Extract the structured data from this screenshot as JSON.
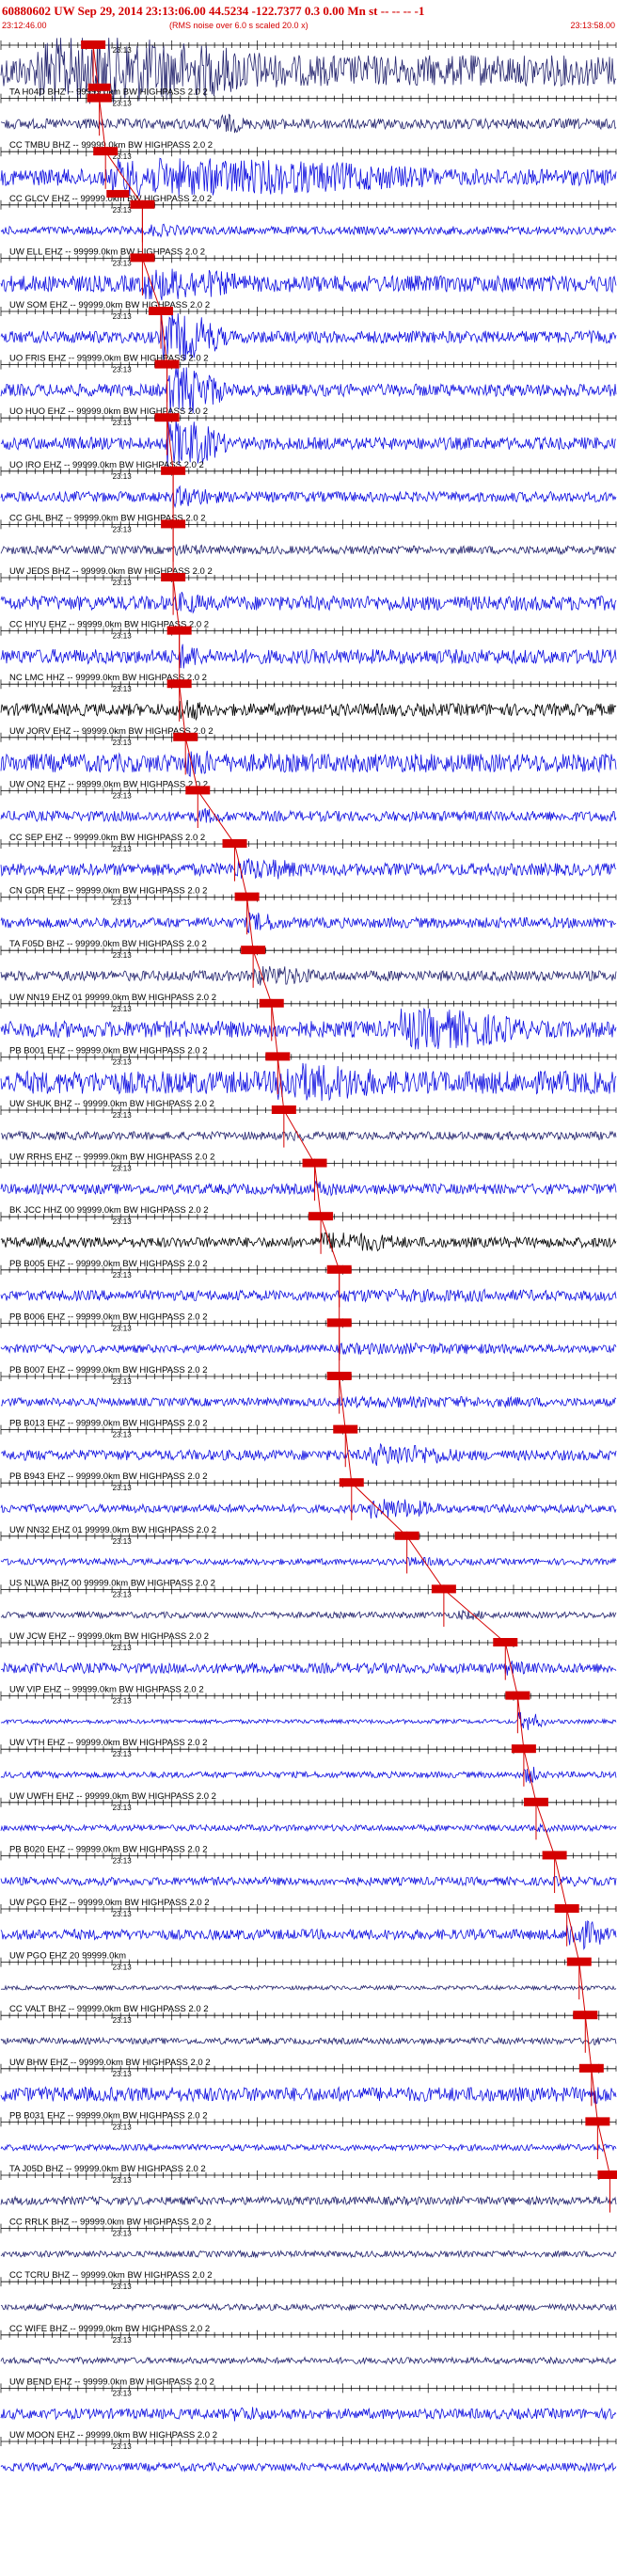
{
  "header": {
    "title": "60880602 UW Sep 29, 2014 23:13:06.00   44.5234 -122.7377  0.3 0.00 Mn st -- -- --  -1",
    "start_time": "23:12:46.00",
    "note": "(RMS noise over 6.0 s scaled 20.0 x)",
    "end_time": "23:13:58.00"
  },
  "colors": {
    "header_text": "#d40000",
    "trace_blue": "#1010e0",
    "trace_navy": "#24246e",
    "trace_black": "#000000",
    "pick_marker": "#d40000",
    "baseline": "#000000"
  },
  "minute_label": "'23:13",
  "chart_data": {
    "type": "seismogram",
    "time_start": "23:12:46.00",
    "time_end": "23:13:58.00",
    "event_origin": "23:13:06.00",
    "traces": [
      {
        "label": "",
        "color": "navy",
        "amp": 30,
        "burst_start": 0.06,
        "burst_end": 0.45,
        "burst_amp": 2.2,
        "pick": 0.15,
        "second_pick": 0.16
      },
      {
        "label": "TA H04D BHZ -- 99999.0km BW  HIGHPASS  2.0  2",
        "color": "navy",
        "amp": 10,
        "burst_start": 0.35,
        "burst_end": 0.4,
        "burst_amp": 2.0,
        "pick": 0.16
      },
      {
        "label": "CC TMBU BHZ -- 99999.0km BW  HIGHPASS  2.0  2",
        "color": "blue",
        "amp": 16,
        "burst_start": 0.18,
        "burst_end": 0.72,
        "burst_amp": 2.3,
        "pick": 0.17,
        "second_pick": 0.19
      },
      {
        "label": "CC GLCV EHZ -- 99999.0km BW  HIGHPASS  2.0  2",
        "color": "blue",
        "amp": 8,
        "burst_start": 0.24,
        "burst_end": 0.3,
        "burst_amp": 1.6,
        "pick": 0.23
      },
      {
        "label": "UW ELL EHZ -- 99999.0km BW  HIGHPASS  2.0  2",
        "color": "blue",
        "amp": 16,
        "burst_start": 0.23,
        "burst_end": 0.4,
        "burst_amp": 2.0,
        "pick": 0.23
      },
      {
        "label": "UW SOM EHZ -- 99999.0km BW  HIGHPASS  2.0  2",
        "color": "blue",
        "amp": 12,
        "burst_start": 0.26,
        "burst_end": 0.37,
        "burst_amp": 4.0,
        "pick": 0.26
      },
      {
        "label": "UO FRIS EHZ -- 99999.0km BW  HIGHPASS  2.0  2",
        "color": "blue",
        "amp": 12,
        "burst_start": 0.27,
        "burst_end": 0.37,
        "burst_amp": 4.0,
        "pick": 0.27
      },
      {
        "label": "UO HUO EHZ -- 99999.0km BW  HIGHPASS  2.0  2",
        "color": "blue",
        "amp": 12,
        "burst_start": 0.27,
        "burst_end": 0.37,
        "burst_amp": 4.0,
        "pick": 0.27
      },
      {
        "label": "UO IRO EHZ -- 99999.0km BW  HIGHPASS  2.0  2",
        "color": "blue",
        "amp": 10,
        "burst_start": 0.28,
        "burst_end": 0.36,
        "burst_amp": 2.0,
        "pick": 0.28
      },
      {
        "label": "CC GHL BHZ -- 99999.0km BW  HIGHPASS  2.0  2",
        "color": "navy",
        "amp": 8,
        "burst_start": 0.28,
        "burst_end": 0.34,
        "burst_amp": 1.4,
        "pick": 0.28
      },
      {
        "label": "UW JEDS BHZ -- 99999.0km BW  HIGHPASS  2.0  2",
        "color": "blue",
        "amp": 14,
        "burst_start": 0.29,
        "burst_end": 0.33,
        "burst_amp": 1.6,
        "pick": 0.28
      },
      {
        "label": "CC HIYU EHZ -- 99999.0km BW  HIGHPASS  2.0  2",
        "color": "blue",
        "amp": 14,
        "burst_start": 0.29,
        "burst_end": 0.33,
        "burst_amp": 1.8,
        "pick": 0.29
      },
      {
        "label": "NC LMC HHZ -- 99999.0km BW  HIGHPASS  2.0  2",
        "color": "black",
        "amp": 12,
        "burst_start": 0.29,
        "burst_end": 0.33,
        "burst_amp": 2.0,
        "pick": 0.29
      },
      {
        "label": "UW JORV EHZ -- 99999.0km BW  HIGHPASS  2.0  2",
        "color": "blue",
        "amp": 18,
        "burst_start": 0.3,
        "burst_end": 0.35,
        "burst_amp": 1.6,
        "pick": 0.3
      },
      {
        "label": "UW ON2 EHZ -- 99999.0km BW  HIGHPASS  2.0  2",
        "color": "blue",
        "amp": 10,
        "burst_start": 0.32,
        "burst_end": 0.36,
        "burst_amp": 1.6,
        "pick": 0.32
      },
      {
        "label": "CC SEP EHZ -- 99999.0km BW  HIGHPASS  2.0  2",
        "color": "blue",
        "amp": 12,
        "burst_start": 0.38,
        "burst_end": 0.5,
        "burst_amp": 1.8,
        "pick": 0.38
      },
      {
        "label": "CN GDR EHZ -- 99999.0km BW  HIGHPASS  2.0  2",
        "color": "blue",
        "amp": 10,
        "burst_start": 0.4,
        "burst_end": 0.46,
        "burst_amp": 2.0,
        "pick": 0.4
      },
      {
        "label": "TA F05D BHZ -- 99999.0km BW  HIGHPASS  2.0  2",
        "color": "navy",
        "amp": 10,
        "burst_start": 0.41,
        "burst_end": 0.52,
        "burst_amp": 2.0,
        "pick": 0.41
      },
      {
        "label": "UW NN19 EHZ 01 99999.0km BW  HIGHPASS  2.0  2",
        "color": "blue",
        "amp": 16,
        "burst_start": 0.65,
        "burst_end": 0.86,
        "burst_amp": 2.5,
        "pick": 0.44
      },
      {
        "label": "PB B001 EHZ -- 99999.0km BW  HIGHPASS  2.0  2",
        "color": "blue",
        "amp": 22,
        "burst_start": 0.45,
        "burst_end": 0.62,
        "burst_amp": 1.8,
        "pick": 0.45
      },
      {
        "label": "UW SHUK BHZ -- 99999.0km BW  HIGHPASS  2.0  2",
        "color": "navy",
        "amp": 8,
        "burst_start": 0.47,
        "burst_end": 0.5,
        "burst_amp": 1.4,
        "pick": 0.46
      },
      {
        "label": "UW RRHS EHZ -- 99999.0km BW  HIGHPASS  2.0  2",
        "color": "blue",
        "amp": 10,
        "burst_start": 0.51,
        "burst_end": 0.55,
        "burst_amp": 1.6,
        "pick": 0.51
      },
      {
        "label": "BK JCC HHZ 00 99999.0km BW  HIGHPASS  2.0  2",
        "color": "black",
        "amp": 10,
        "burst_start": 0.52,
        "burst_end": 0.66,
        "burst_amp": 2.0,
        "pick": 0.52
      },
      {
        "label": "PB B005 EHZ -- 99999.0km BW  HIGHPASS  2.0  2",
        "color": "blue",
        "amp": 10,
        "burst_start": 0.55,
        "burst_end": 0.9,
        "burst_amp": 1.3,
        "pick": 0.55
      },
      {
        "label": "PB B006 EHZ -- 99999.0km BW  HIGHPASS  2.0  2",
        "color": "blue",
        "amp": 8,
        "burst_start": 0.55,
        "burst_end": 0.9,
        "burst_amp": 1.4,
        "pick": 0.55
      },
      {
        "label": "PB B007 EHZ -- 99999.0km BW  HIGHPASS  2.0  2",
        "color": "blue",
        "amp": 8,
        "burst_start": 0.55,
        "burst_end": 0.95,
        "burst_amp": 1.4,
        "pick": 0.55
      },
      {
        "label": "PB B013 EHZ -- 99999.0km BW  HIGHPASS  2.0  2",
        "color": "blue",
        "amp": 10,
        "burst_start": 0.6,
        "burst_end": 0.75,
        "burst_amp": 2.2,
        "pick": 0.56
      },
      {
        "label": "PB B943 EHZ -- 99999.0km BW  HIGHPASS  2.0  2",
        "color": "blue",
        "amp": 8,
        "burst_start": 0.6,
        "burst_end": 0.72,
        "burst_amp": 2.5,
        "pick": 0.57
      },
      {
        "label": "UW NN32 EHZ 01 99999.0km BW  HIGHPASS  2.0  2",
        "color": "blue",
        "amp": 6,
        "burst_start": 0.66,
        "burst_end": 0.74,
        "burst_amp": 1.5,
        "pick": 0.66
      },
      {
        "label": "US NLWA BHZ 00 99999.0km BW  HIGHPASS  2.0  2",
        "color": "navy",
        "amp": 6,
        "burst_start": 0.74,
        "burst_end": 0.8,
        "burst_amp": 1.6,
        "pick": 0.72
      },
      {
        "label": "UW JCW EHZ -- 99999.0km BW  HIGHPASS  2.0  2",
        "color": "blue",
        "amp": 10,
        "burst_start": 0.82,
        "burst_end": 0.86,
        "burst_amp": 1.5,
        "pick": 0.82
      },
      {
        "label": "UW VIP EHZ -- 99999.0km BW  HIGHPASS  2.0  2",
        "color": "blue",
        "amp": 4,
        "burst_start": 0.84,
        "burst_end": 0.89,
        "burst_amp": 4.5,
        "pick": 0.84
      },
      {
        "label": "UW VTH EHZ -- 99999.0km BW  HIGHPASS  2.0  2",
        "color": "blue",
        "amp": 6,
        "burst_start": 0.85,
        "burst_end": 0.88,
        "burst_amp": 3.0,
        "pick": 0.85
      },
      {
        "label": "UW UWFH EHZ -- 99999.0km BW  HIGHPASS  2.0  2",
        "color": "blue",
        "amp": 6,
        "burst_start": 0.87,
        "burst_end": 0.9,
        "burst_amp": 1.3,
        "pick": 0.87
      },
      {
        "label": "PB B020 EHZ -- 99999.0km BW  HIGHPASS  2.0  2",
        "color": "blue",
        "amp": 8,
        "burst_start": 0.9,
        "burst_end": 0.95,
        "burst_amp": 1.3,
        "pick": 0.9
      },
      {
        "label": "UW PGO EHZ -- 99999.0km BW  HIGHPASS  2.0  2",
        "color": "blue",
        "amp": 10,
        "burst_start": 0.92,
        "burst_end": 0.99,
        "burst_amp": 3.0,
        "pick": 0.92
      },
      {
        "label": "UW PGO EHZ 20 99999.0km",
        "color": "navy",
        "amp": 4,
        "burst_start": 0.94,
        "burst_end": 0.97,
        "burst_amp": 1.2,
        "pick": 0.94
      },
      {
        "label": "CC VALT BHZ -- 99999.0km BW  HIGHPASS  2.0  2",
        "color": "navy",
        "amp": 6,
        "burst_start": 0.95,
        "burst_end": 0.98,
        "burst_amp": 1.3,
        "pick": 0.95
      },
      {
        "label": "UW BHW EHZ -- 99999.0km BW  HIGHPASS  2.0  2",
        "color": "blue",
        "amp": 14,
        "burst_start": 0.96,
        "burst_end": 0.99,
        "burst_amp": 1.4,
        "pick": 0.96
      },
      {
        "label": "PB B031 EHZ -- 99999.0km BW  HIGHPASS  2.0  2",
        "color": "blue",
        "amp": 6,
        "burst_start": 0.97,
        "burst_end": 0.99,
        "burst_amp": 1.3,
        "pick": 0.97
      },
      {
        "label": "TA J05D BHZ -- 99999.0km BW  HIGHPASS  2.0  2",
        "color": "navy",
        "amp": 8,
        "burst_start": 0.98,
        "burst_end": 0.99,
        "burst_amp": 1.0,
        "pick": 0.99
      },
      {
        "label": "CC RRLK BHZ -- 99999.0km BW  HIGHPASS  2.0  2",
        "color": "navy",
        "amp": 6,
        "burst_start": 0.98,
        "burst_end": 0.99,
        "burst_amp": 1.0
      },
      {
        "label": "CC TCRU BHZ -- 99999.0km BW  HIGHPASS  2.0  2",
        "color": "navy",
        "amp": 6,
        "burst_start": 0.98,
        "burst_end": 0.99,
        "burst_amp": 1.0
      },
      {
        "label": "CC WIFE BHZ -- 99999.0km BW  HIGHPASS  2.0  2",
        "color": "navy",
        "amp": 6,
        "burst_start": 0.98,
        "burst_end": 0.99,
        "burst_amp": 1.0
      },
      {
        "label": "UW BEND EHZ -- 99999.0km BW  HIGHPASS  2.0  2",
        "color": "blue",
        "amp": 10,
        "burst_start": 0.38,
        "burst_end": 0.44,
        "burst_amp": 1.5
      },
      {
        "label": "UW MOON EHZ -- 99999.0km BW  HIGHPASS  2.0  2",
        "color": "blue",
        "amp": 8,
        "burst_start": 0.98,
        "burst_end": 0.99,
        "burst_amp": 1.0
      }
    ]
  }
}
